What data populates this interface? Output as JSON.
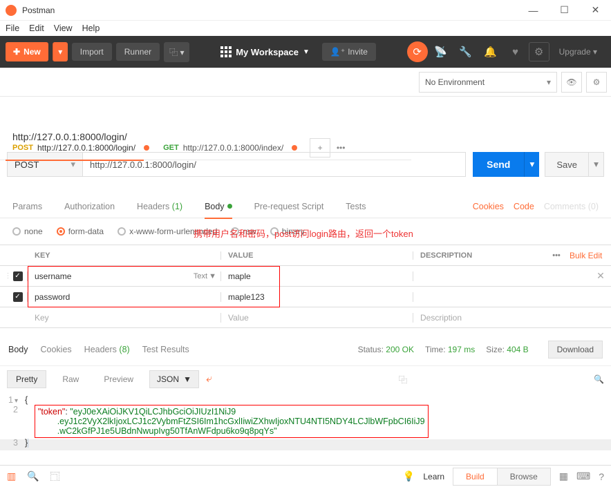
{
  "window": {
    "title": "Postman"
  },
  "menu": {
    "file": "File",
    "edit": "Edit",
    "view": "View",
    "help": "Help"
  },
  "toolbar": {
    "new": "New",
    "import": "Import",
    "runner": "Runner",
    "workspace": "My Workspace",
    "invite": "Invite",
    "upgrade": "Upgrade"
  },
  "env": {
    "selected": "No Environment"
  },
  "tabs": {
    "t1_method": "POST",
    "t1_url": "http://127.0.0.1:8000/login/",
    "t2_method": "GET",
    "t2_url": "http://127.0.0.1:8000/index/"
  },
  "request": {
    "title": "http://127.0.0.1:8000/login/",
    "method": "POST",
    "url": "http://127.0.0.1:8000/login/",
    "send": "Send",
    "save": "Save"
  },
  "annotation": "携带用户名和密码，post访问login路由，返回一个token",
  "rtabs": {
    "params": "Params",
    "auth": "Authorization",
    "headers": "Headers",
    "headers_count": "(1)",
    "body": "Body",
    "prereq": "Pre-request Script",
    "tests": "Tests",
    "cookies": "Cookies",
    "code": "Code",
    "comments": "Comments (0)"
  },
  "bodytype": {
    "none": "none",
    "form": "form-data",
    "url": "x-www-form-urlencoded",
    "raw": "raw",
    "bin": "binary"
  },
  "kv": {
    "hkey": "KEY",
    "hval": "VALUE",
    "hdesc": "DESCRIPTION",
    "bulk": "Bulk Edit",
    "r1k": "username",
    "r1t": "Text",
    "r1v": "maple",
    "r2k": "password",
    "r2v": "maple123",
    "pk": "Key",
    "pv": "Value",
    "pd": "Description"
  },
  "resp": {
    "body": "Body",
    "cookies": "Cookies",
    "headers": "Headers",
    "hcount": "(8)",
    "tests": "Test Results",
    "status_l": "Status:",
    "status_v": "200 OK",
    "time_l": "Time:",
    "time_v": "197 ms",
    "size_l": "Size:",
    "size_v": "404 B",
    "download": "Download"
  },
  "fmt": {
    "pretty": "Pretty",
    "raw": "Raw",
    "preview": "Preview",
    "type": "JSON"
  },
  "json": {
    "l1": "{",
    "key": "\"token\"",
    "v1": "\"eyJ0eXAiOiJKV1QiLCJhbGciOiJIUzI1NiJ9",
    "v2": ".eyJ1c2VyX2lkIjoxLCJ1c2VybmFtZSI6Im1hcGxlIiwiZXhwIjoxNTU4NTI5NDY4LCJlbWFpbCI6IiJ9",
    "v3": ".wC2kGfPJ1e5UBdnNwupIvg50TfAnWFdpu6ko9q8pqYs\"",
    "l3": "}"
  },
  "status": {
    "learn": "Learn",
    "build": "Build",
    "browse": "Browse"
  }
}
